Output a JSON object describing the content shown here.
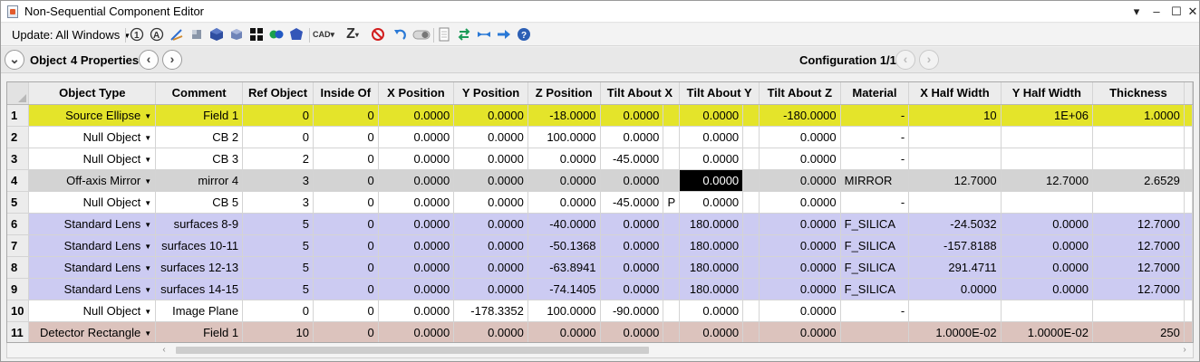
{
  "window": {
    "title": "Non-Sequential Component Editor",
    "controls": [
      "▾",
      "–",
      "☐",
      "✕"
    ]
  },
  "toolbar": {
    "update_label": "Update: All Windows",
    "cad_label": "CAD",
    "z_label": "Z"
  },
  "propbar": {
    "object_label": "Object",
    "properties_label": "4 Properties",
    "configuration_label": "Configuration 1/1"
  },
  "grid": {
    "columns": [
      "Object Type",
      "Comment",
      "Ref Object",
      "Inside Of",
      "X Position",
      "Y Position",
      "Z Position",
      "Tilt About X",
      "Tilt About Y",
      "Tilt About Z",
      "Material",
      "X Half Width",
      "Y Half Width",
      "Thickness"
    ],
    "rows": [
      {
        "n": "1",
        "type": "Source Ellipse",
        "comment": "Field 1",
        "ref": "0",
        "inside": "0",
        "xpos": "0.0000",
        "ypos": "0.0000",
        "zpos": "-18.0000",
        "tx": "0.0000",
        "txs": "",
        "ty": "0.0000",
        "tys": "",
        "tz": "-180.0000",
        "mat": "-",
        "xhw": "10",
        "yhw": "1E+06",
        "thick": "1.0000"
      },
      {
        "n": "2",
        "type": "Null Object",
        "comment": "CB 2",
        "ref": "0",
        "inside": "0",
        "xpos": "0.0000",
        "ypos": "0.0000",
        "zpos": "100.0000",
        "tx": "0.0000",
        "txs": "",
        "ty": "0.0000",
        "tys": "",
        "tz": "0.0000",
        "mat": "-",
        "xhw": "",
        "yhw": "",
        "thick": ""
      },
      {
        "n": "3",
        "type": "Null Object",
        "comment": "CB 3",
        "ref": "2",
        "inside": "0",
        "xpos": "0.0000",
        "ypos": "0.0000",
        "zpos": "0.0000",
        "tx": "-45.0000",
        "txs": "",
        "ty": "0.0000",
        "tys": "",
        "tz": "0.0000",
        "mat": "-",
        "xhw": "",
        "yhw": "",
        "thick": ""
      },
      {
        "n": "4",
        "type": "Off-axis Mirror",
        "comment": "mirror 4",
        "ref": "3",
        "inside": "0",
        "xpos": "0.0000",
        "ypos": "0.0000",
        "zpos": "0.0000",
        "tx": "0.0000",
        "txs": "",
        "ty": "0.0000",
        "tys": "",
        "tz": "0.0000",
        "mat": "MIRROR",
        "xhw": "12.7000",
        "yhw": "12.7000",
        "thick": "2.6529"
      },
      {
        "n": "5",
        "type": "Null Object",
        "comment": "CB 5",
        "ref": "3",
        "inside": "0",
        "xpos": "0.0000",
        "ypos": "0.0000",
        "zpos": "0.0000",
        "tx": "-45.0000",
        "txs": "P",
        "ty": "0.0000",
        "tys": "",
        "tz": "0.0000",
        "mat": "-",
        "xhw": "",
        "yhw": "",
        "thick": ""
      },
      {
        "n": "6",
        "type": "Standard Lens",
        "comment": "surfaces 8-9",
        "ref": "5",
        "inside": "0",
        "xpos": "0.0000",
        "ypos": "0.0000",
        "zpos": "-40.0000",
        "tx": "0.0000",
        "txs": "",
        "ty": "180.0000",
        "tys": "",
        "tz": "0.0000",
        "mat": "F_SILICA",
        "xhw": "-24.5032",
        "yhw": "0.0000",
        "thick": "12.7000"
      },
      {
        "n": "7",
        "type": "Standard Lens",
        "comment": "surfaces 10-11",
        "ref": "5",
        "inside": "0",
        "xpos": "0.0000",
        "ypos": "0.0000",
        "zpos": "-50.1368",
        "tx": "0.0000",
        "txs": "",
        "ty": "180.0000",
        "tys": "",
        "tz": "0.0000",
        "mat": "F_SILICA",
        "xhw": "-157.8188",
        "yhw": "0.0000",
        "thick": "12.7000"
      },
      {
        "n": "8",
        "type": "Standard Lens",
        "comment": "surfaces 12-13",
        "ref": "5",
        "inside": "0",
        "xpos": "0.0000",
        "ypos": "0.0000",
        "zpos": "-63.8941",
        "tx": "0.0000",
        "txs": "",
        "ty": "180.0000",
        "tys": "",
        "tz": "0.0000",
        "mat": "F_SILICA",
        "xhw": "291.4711",
        "yhw": "0.0000",
        "thick": "12.7000"
      },
      {
        "n": "9",
        "type": "Standard Lens",
        "comment": "surfaces 14-15",
        "ref": "5",
        "inside": "0",
        "xpos": "0.0000",
        "ypos": "0.0000",
        "zpos": "-74.1405",
        "tx": "0.0000",
        "txs": "",
        "ty": "180.0000",
        "tys": "",
        "tz": "0.0000",
        "mat": "F_SILICA",
        "xhw": "0.0000",
        "yhw": "0.0000",
        "thick": "12.7000"
      },
      {
        "n": "10",
        "type": "Null Object",
        "comment": "Image Plane",
        "ref": "0",
        "inside": "0",
        "xpos": "0.0000",
        "ypos": "-178.3352",
        "zpos": "100.0000",
        "tx": "-90.0000",
        "txs": "",
        "ty": "0.0000",
        "tys": "",
        "tz": "0.0000",
        "mat": "-",
        "xhw": "",
        "yhw": "",
        "thick": ""
      },
      {
        "n": "11",
        "type": "Detector Rectangle",
        "comment": "Field 1",
        "ref": "10",
        "inside": "0",
        "xpos": "0.0000",
        "ypos": "0.0000",
        "zpos": "0.0000",
        "tx": "0.0000",
        "txs": "",
        "ty": "0.0000",
        "tys": "",
        "tz": "0.0000",
        "mat": "",
        "xhw": "1.0000E-02",
        "yhw": "1.0000E-02",
        "thick": "250"
      }
    ]
  },
  "colors": {
    "source_row": "#e4e42a",
    "mirror_row": "#d3d3d3",
    "lens_row": "#cccbf2",
    "detector_row": "#dcc3bd",
    "selected_cell": "#000000"
  }
}
